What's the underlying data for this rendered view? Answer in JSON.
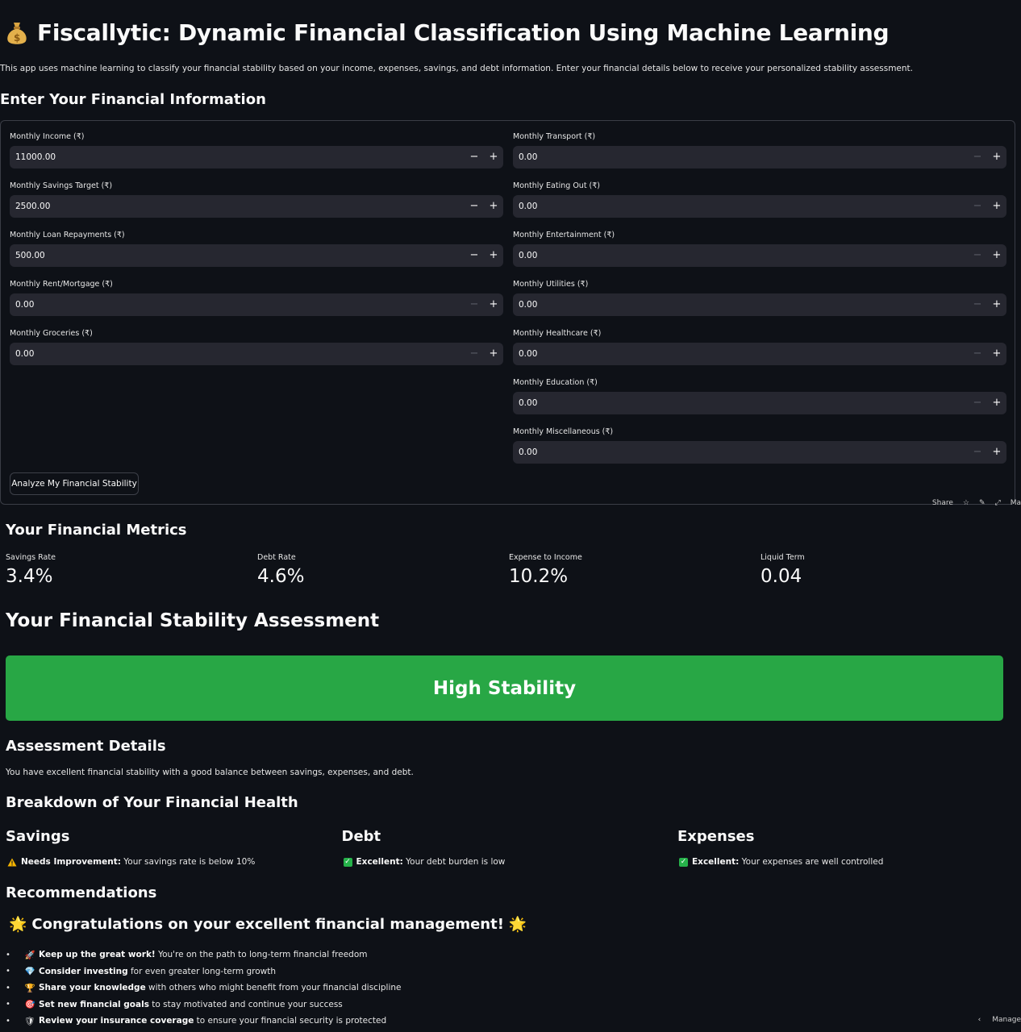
{
  "header": {
    "title": "Fiscallytic: Dynamic Financial Classification Using Machine Learning",
    "intro": "This app uses machine learning to classify your financial stability based on your income, expenses, savings, and debt information. Enter your financial details below to receive your personalized stability assessment."
  },
  "form": {
    "heading": "Enter Your Financial Information",
    "left_fields": [
      {
        "label": "Monthly Income (₹)",
        "value": "11000.00"
      },
      {
        "label": "Monthly Savings Target (₹)",
        "value": "2500.00"
      },
      {
        "label": "Monthly Loan Repayments (₹)",
        "value": "500.00"
      },
      {
        "label": "Monthly Rent/Mortgage (₹)",
        "value": "0.00"
      },
      {
        "label": "Monthly Groceries (₹)",
        "value": "0.00"
      }
    ],
    "right_fields": [
      {
        "label": "Monthly Transport (₹)",
        "value": "0.00"
      },
      {
        "label": "Monthly Eating Out (₹)",
        "value": "0.00"
      },
      {
        "label": "Monthly Entertainment (₹)",
        "value": "0.00"
      },
      {
        "label": "Monthly Utilities (₹)",
        "value": "0.00"
      },
      {
        "label": "Monthly Healthcare (₹)",
        "value": "0.00"
      },
      {
        "label": "Monthly Education (₹)",
        "value": "0.00"
      },
      {
        "label": "Monthly Miscellaneous (₹)",
        "value": "0.00"
      }
    ],
    "minus_symbol": "−",
    "plus_symbol": "+",
    "analyze_button": "Analyze My Financial Stability"
  },
  "toolbar": {
    "share_label": "Share",
    "more_label": "Ma"
  },
  "metrics": {
    "heading": "Your Financial Metrics",
    "items": [
      {
        "label": "Savings Rate",
        "value": "3.4%"
      },
      {
        "label": "Debt Rate",
        "value": "4.6%"
      },
      {
        "label": "Expense to Income",
        "value": "10.2%"
      },
      {
        "label": "Liquid Term",
        "value": "0.04"
      }
    ]
  },
  "assessment": {
    "heading": "Your Financial Stability Assessment",
    "result": "High Stability",
    "result_color": "#28a745",
    "details_heading": "Assessment Details",
    "details_text": "You have excellent financial stability with a good balance between savings, expenses, and debt."
  },
  "breakdown": {
    "heading": "Breakdown of Your Financial Health",
    "columns": [
      {
        "title": "Savings",
        "icon": "warning-icon",
        "status": "Needs Improvement:",
        "text": "Your savings rate is below 10%"
      },
      {
        "title": "Debt",
        "icon": "check-icon",
        "status": "Excellent:",
        "text": "Your debt burden is low"
      },
      {
        "title": "Expenses",
        "icon": "check-icon",
        "status": "Excellent:",
        "text": "Your expenses are well controlled"
      }
    ]
  },
  "recommendations": {
    "heading": "Recommendations",
    "congrats": "Congratulations on your excellent financial management!",
    "items": [
      {
        "icon": "🚀",
        "bold": "Keep up the great work!",
        "text": " You're on the path to long-term financial freedom"
      },
      {
        "icon": "💎",
        "bold": "Consider investing",
        "text": " for even greater long-term growth"
      },
      {
        "icon": "🏆",
        "bold": "Share your knowledge",
        "text": " with others who might benefit from your financial discipline"
      },
      {
        "icon": "🎯",
        "bold": "Set new financial goals",
        "text": " to stay motivated and continue your success"
      },
      {
        "icon": "🛡",
        "bold": "Review your insurance coverage",
        "text": " to ensure your financial security is protected"
      }
    ]
  },
  "footer": {
    "manage_label": "Manage"
  }
}
